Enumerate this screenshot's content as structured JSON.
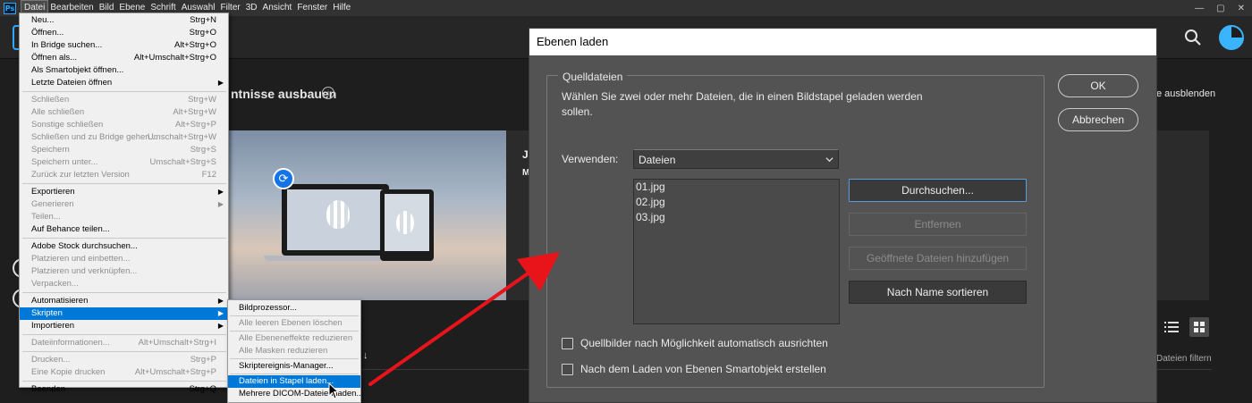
{
  "app": {
    "logo_text": "Ps",
    "menu": [
      "Datei",
      "Bearbeiten",
      "Bild",
      "Ebene",
      "Schrift",
      "Auswahl",
      "Filter",
      "3D",
      "Ansicht",
      "Fenster",
      "Hilfe"
    ],
    "window_controls": [
      "—",
      "▢",
      "✕"
    ]
  },
  "home": {
    "heading": "ntnisse ausbauen",
    "hide_link": "e ausblenden",
    "hero_text_1": "Je",
    "hero_text_2": "M",
    "filter_text": "Dateien filtern",
    "sort_arrow": "↓"
  },
  "file_menu": {
    "items": [
      {
        "label": "Neu...",
        "shortcut": "Strg+N",
        "disabled": false
      },
      {
        "label": "Öffnen...",
        "shortcut": "Strg+O",
        "disabled": false
      },
      {
        "label": "In Bridge suchen...",
        "shortcut": "Alt+Strg+O",
        "disabled": false
      },
      {
        "label": "Öffnen als...",
        "shortcut": "Alt+Umschalt+Strg+O",
        "disabled": false
      },
      {
        "label": "Als Smartobjekt öffnen...",
        "shortcut": "",
        "disabled": false
      },
      {
        "label": "Letzte Dateien öffnen",
        "shortcut": "",
        "disabled": false,
        "submenu": true
      },
      {
        "sep": true
      },
      {
        "label": "Schließen",
        "shortcut": "Strg+W",
        "disabled": true
      },
      {
        "label": "Alle schließen",
        "shortcut": "Alt+Strg+W",
        "disabled": true
      },
      {
        "label": "Sonstige schließen",
        "shortcut": "Alt+Strg+P",
        "disabled": true
      },
      {
        "label": "Schließen und zu Bridge gehen...",
        "shortcut": "Umschalt+Strg+W",
        "disabled": true
      },
      {
        "label": "Speichern",
        "shortcut": "Strg+S",
        "disabled": true
      },
      {
        "label": "Speichern unter...",
        "shortcut": "Umschalt+Strg+S",
        "disabled": true
      },
      {
        "label": "Zurück zur letzten Version",
        "shortcut": "F12",
        "disabled": true
      },
      {
        "sep": true
      },
      {
        "label": "Exportieren",
        "shortcut": "",
        "disabled": false,
        "submenu": true
      },
      {
        "label": "Generieren",
        "shortcut": "",
        "disabled": true,
        "submenu": true
      },
      {
        "label": "Teilen...",
        "shortcut": "",
        "disabled": true
      },
      {
        "label": "Auf Behance teilen...",
        "shortcut": "",
        "disabled": false
      },
      {
        "sep": true
      },
      {
        "label": "Adobe Stock durchsuchen...",
        "shortcut": "",
        "disabled": false
      },
      {
        "label": "Platzieren und einbetten...",
        "shortcut": "",
        "disabled": true
      },
      {
        "label": "Platzieren und verknüpfen...",
        "shortcut": "",
        "disabled": true
      },
      {
        "label": "Verpacken...",
        "shortcut": "",
        "disabled": true
      },
      {
        "sep": true
      },
      {
        "label": "Automatisieren",
        "shortcut": "",
        "disabled": false,
        "submenu": true
      },
      {
        "label": "Skripten",
        "shortcut": "",
        "disabled": false,
        "submenu": true,
        "selected": true
      },
      {
        "label": "Importieren",
        "shortcut": "",
        "disabled": false,
        "submenu": true
      },
      {
        "sep": true
      },
      {
        "label": "Dateiinformationen...",
        "shortcut": "Alt+Umschalt+Strg+I",
        "disabled": true
      },
      {
        "sep": true
      },
      {
        "label": "Drucken...",
        "shortcut": "Strg+P",
        "disabled": true
      },
      {
        "label": "Eine Kopie drucken",
        "shortcut": "Alt+Umschalt+Strg+P",
        "disabled": true
      },
      {
        "sep": true
      },
      {
        "label": "Beenden",
        "shortcut": "Strg+Q",
        "disabled": false
      }
    ]
  },
  "script_menu": {
    "items": [
      {
        "label": "Bildprozessor...",
        "disabled": false
      },
      {
        "sep": true
      },
      {
        "label": "Alle leeren Ebenen löschen",
        "disabled": true
      },
      {
        "sep": true
      },
      {
        "label": "Alle Ebeneneffekte reduzieren",
        "disabled": true
      },
      {
        "label": "Alle Masken reduzieren",
        "disabled": true
      },
      {
        "sep": true
      },
      {
        "label": "Skriptereignis-Manager...",
        "disabled": false
      },
      {
        "sep": true
      },
      {
        "label": "Dateien in Stapel laden...",
        "disabled": false,
        "selected": true
      },
      {
        "label": "Mehrere DICOM-Dateien laden...",
        "disabled": false
      }
    ]
  },
  "dialog": {
    "title": "Ebenen laden",
    "group_title": "Quelldateien",
    "group_description": "Wählen Sie zwei oder mehr Dateien, die in einen Bildstapel geladen werden sollen.",
    "use_label": "Verwenden:",
    "use_value": "Dateien",
    "files": [
      "01.jpg",
      "02.jpg",
      "03.jpg"
    ],
    "browse_button": "Durchsuchen...",
    "remove_button": "Entfernen",
    "add_open_button": "Geöffnete Dateien hinzufügen",
    "sort_button": "Nach Name sortieren",
    "ok_button": "OK",
    "cancel_button": "Abbrechen",
    "checkbox_align": {
      "label": "Quellbilder nach Möglichkeit automatisch ausrichten",
      "checked": false
    },
    "checkbox_smart": {
      "label": "Nach dem Laden von Ebenen Smartobjekt erstellen",
      "checked": false
    }
  },
  "colors": {
    "accent": "#31a8ff",
    "selection": "#0078d7",
    "annotation_arrow": "#e8141a"
  }
}
